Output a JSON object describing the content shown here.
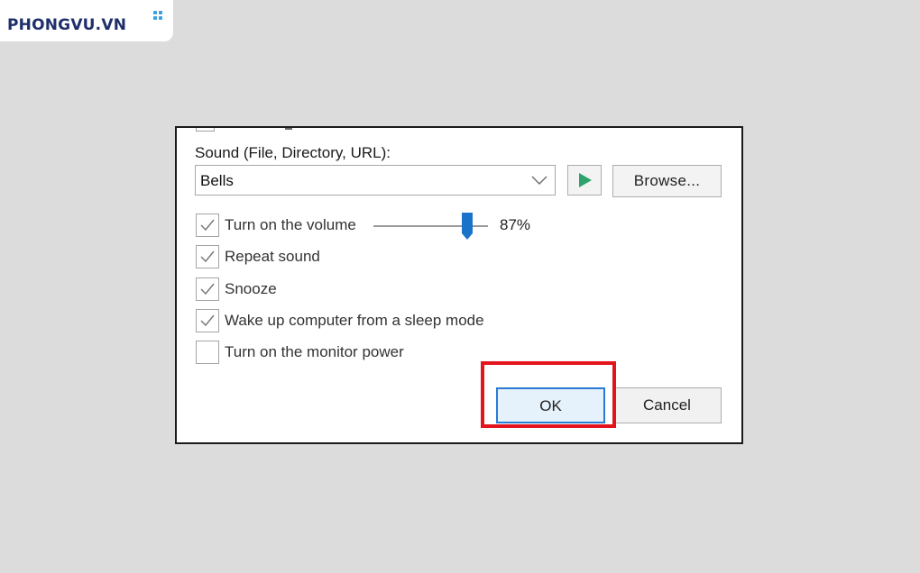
{
  "logo": {
    "text": "PHONGVU.VN"
  },
  "dialog": {
    "sound_label": "Sound (File, Directory, URL):",
    "sound_select": {
      "value": "Bells"
    },
    "play_button": {
      "icon": "play-icon"
    },
    "browse_button": {
      "label": "Browse..."
    },
    "volume": {
      "label": "Turn on the volume",
      "checked": true,
      "percent_label": "87%",
      "level": 0.87
    },
    "options": [
      {
        "label": "Turn on the volume",
        "checked": true
      },
      {
        "label": "Repeat sound",
        "checked": true
      },
      {
        "label": "Snooze",
        "checked": true
      },
      {
        "label": "Wake up computer from a sleep mode",
        "checked": true
      },
      {
        "label": "Turn on the monitor power",
        "checked": false
      }
    ],
    "ok_button": {
      "label": "OK"
    },
    "cancel_button": {
      "label": "Cancel"
    }
  },
  "colors": {
    "play_accent": "#2fa36b",
    "slider_thumb": "#1a73c9",
    "highlight_box": "#e3141b",
    "logo_text": "#1e2f6b",
    "logo_dots": "#3aa0e0"
  }
}
